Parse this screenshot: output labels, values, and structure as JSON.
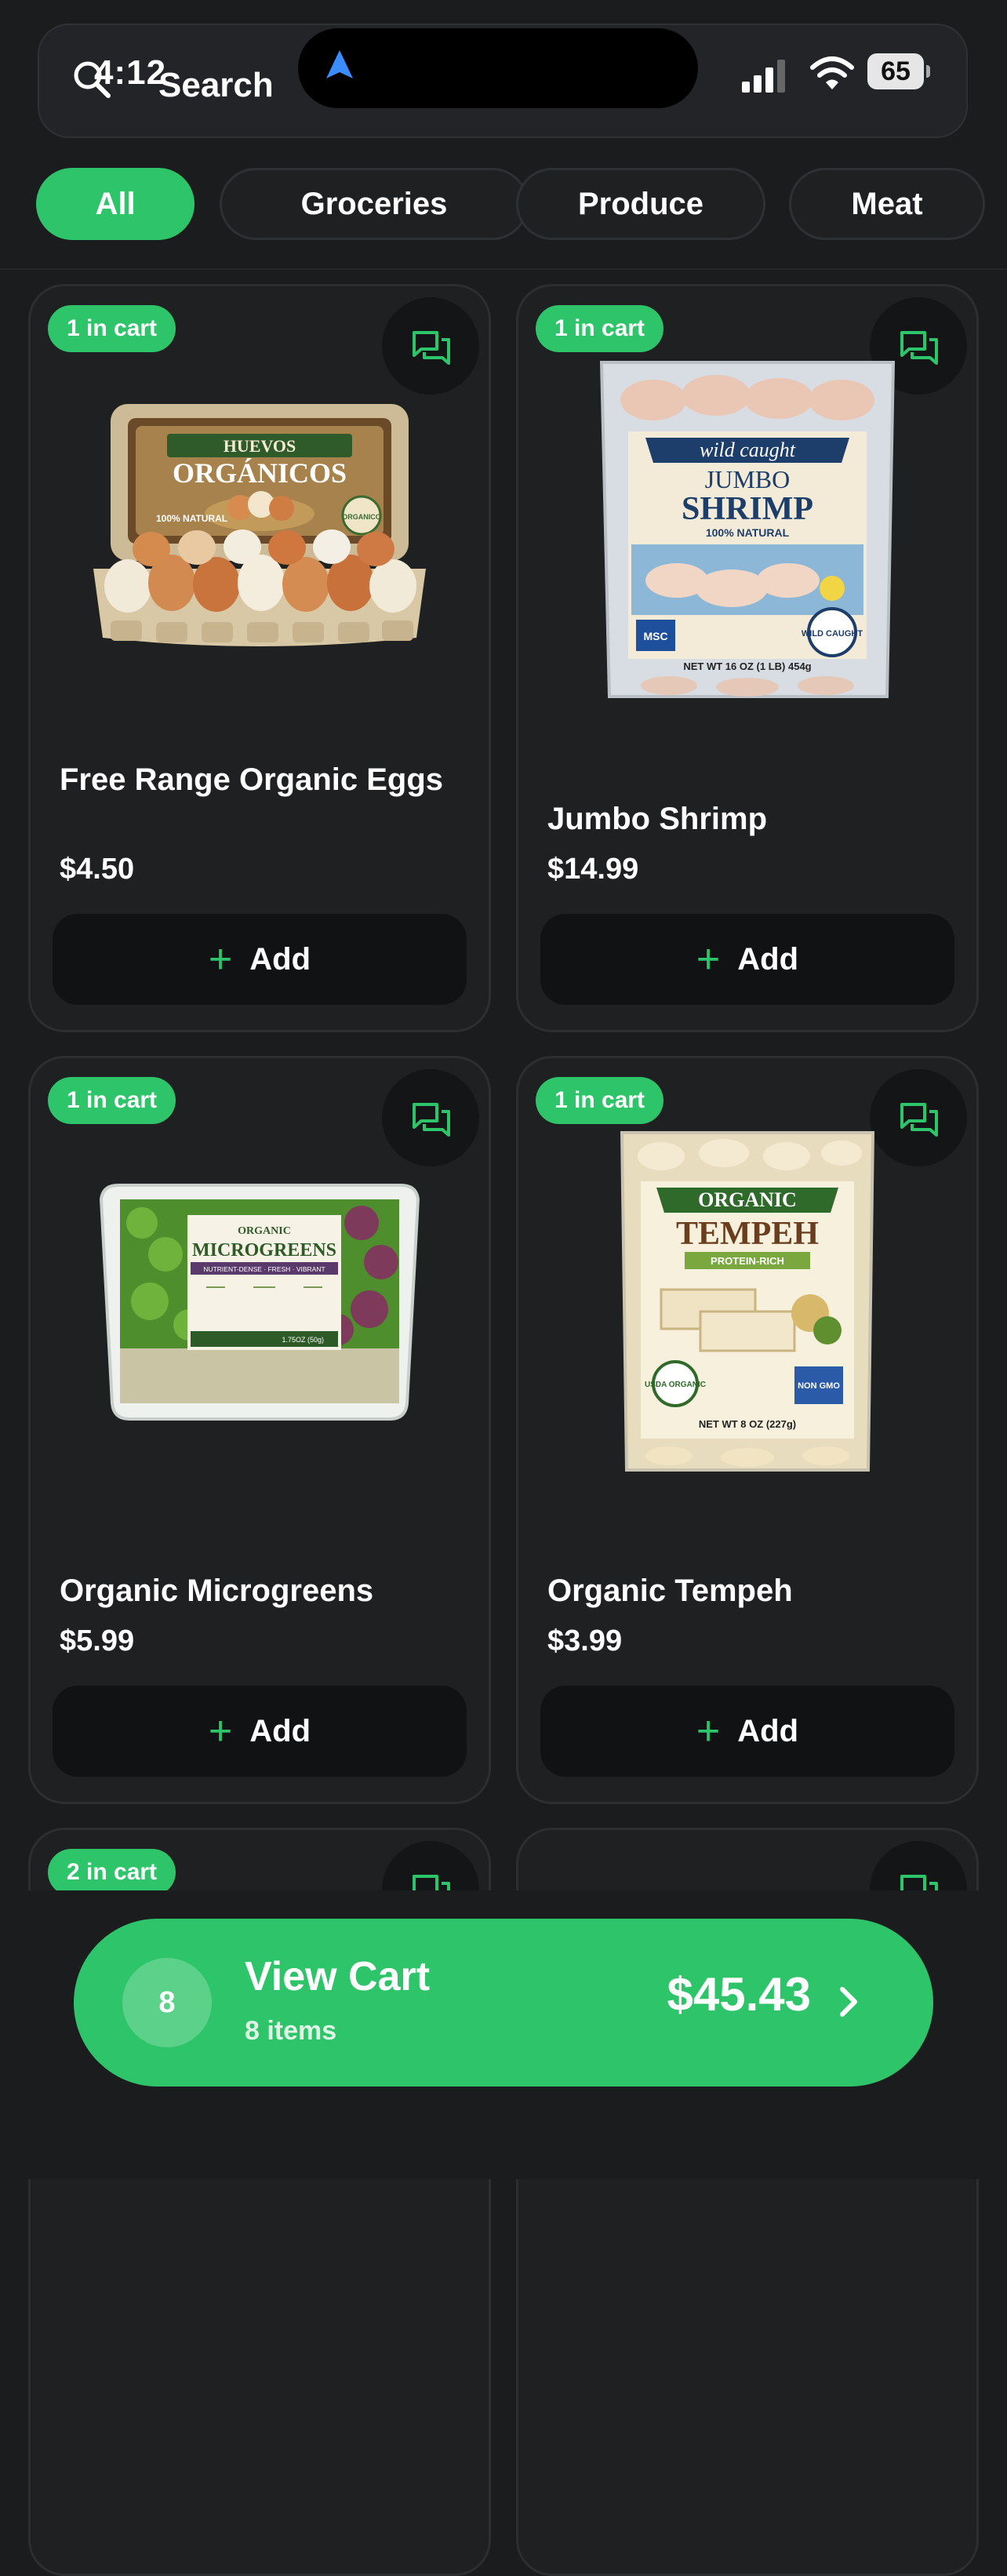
{
  "status": {
    "time": "4:12",
    "battery": "65"
  },
  "search": {
    "label": "Search"
  },
  "filters": [
    {
      "label": "All",
      "active": true
    },
    {
      "label": "Groceries",
      "active": false
    },
    {
      "label": "Produce",
      "active": false
    },
    {
      "label": "Meat",
      "active": false
    }
  ],
  "products": [
    {
      "badge": "1 in cart",
      "name": "Free Range Organic Eggs",
      "price": "$4.50",
      "add_label": "Add",
      "pack_text": {
        "line1": "HUEVOS",
        "line2": "ORGÁNICOS",
        "tag": "100% NATURAL",
        "seal": "ORGANICO"
      }
    },
    {
      "badge": "1 in cart",
      "name": "Jumbo Shrimp",
      "price": "$14.99",
      "add_label": "Add",
      "pack_text": {
        "line1": "wild caught",
        "line2": "JUMBO",
        "line3": "SHRIMP",
        "tag": "100% NATURAL",
        "seal": "WILD CAUGHT",
        "msc": "MSC",
        "net": "NET WT 16 OZ (1 LB) 454g"
      }
    },
    {
      "badge": "1 in cart",
      "name": "Organic Microgreens",
      "price": "$5.99",
      "add_label": "Add",
      "pack_text": {
        "line1": "ORGANIC",
        "line2": "MICROGREENS",
        "tag": "NUTRIENT-DENSE · FRESH · VIBRANT",
        "net": "1.75OZ (50g)"
      }
    },
    {
      "badge": "1 in cart",
      "name": "Organic Tempeh",
      "price": "$3.99",
      "add_label": "Add",
      "pack_text": {
        "line1": "ORGANIC",
        "line2": "TEMPEH",
        "tag": "PROTEIN-RICH",
        "seal": "USDA ORGANIC",
        "seal2": "NON GMO",
        "net": "NET WT 8 OZ (227g)"
      }
    },
    {
      "badge": "2 in cart"
    },
    {
      "badge": ""
    }
  ],
  "cart": {
    "count": "8",
    "title": "View Cart",
    "subtitle": "8 items",
    "total": "$45.43"
  },
  "colors": {
    "accent": "#2dc46a",
    "background": "#1b1c1e",
    "card": "#1f2022"
  }
}
